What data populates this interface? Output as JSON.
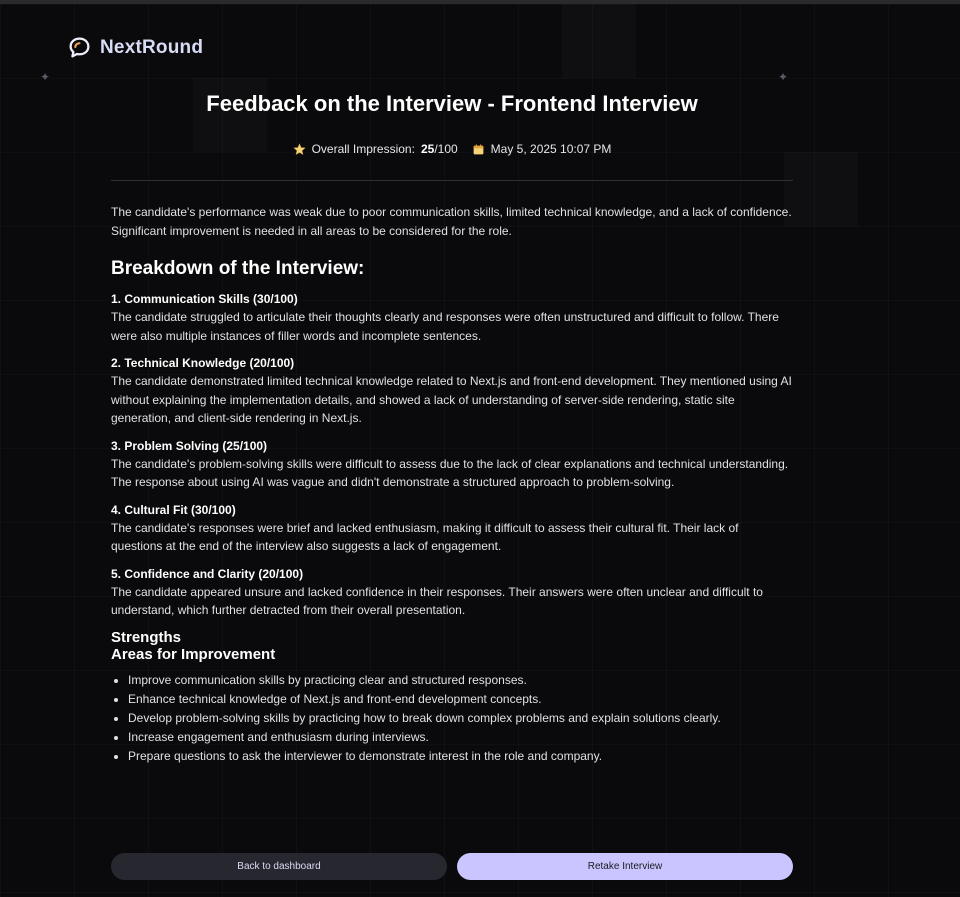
{
  "app": {
    "name": "NextRound"
  },
  "page": {
    "title": "Feedback on the Interview - Frontend Interview"
  },
  "meta": {
    "impression_label": "Overall Impression:",
    "score": "25",
    "score_max": "/100",
    "date": "May 5, 2025 10:07 PM"
  },
  "summary": "The candidate's performance was weak due to poor communication skills, limited technical knowledge, and a lack of confidence. Significant improvement is needed in all areas to be considered for the role.",
  "breakdown": {
    "heading": "Breakdown of the Interview:",
    "categories": [
      {
        "title": "1. Communication Skills (30/100)",
        "comment": "The candidate struggled to articulate their thoughts clearly and responses were often unstructured and difficult to follow. There were also multiple instances of filler words and incomplete sentences."
      },
      {
        "title": "2. Technical Knowledge (20/100)",
        "comment": "The candidate demonstrated limited technical knowledge related to Next.js and front-end development. They mentioned using AI without explaining the implementation details, and showed a lack of understanding of server-side rendering, static site generation, and client-side rendering in Next.js."
      },
      {
        "title": "3. Problem Solving (25/100)",
        "comment": "The candidate's problem-solving skills were difficult to assess due to the lack of clear explanations and technical understanding. The response about using AI was vague and didn't demonstrate a structured approach to problem-solving."
      },
      {
        "title": "4. Cultural Fit (30/100)",
        "comment": "The candidate's responses were brief and lacked enthusiasm, making it difficult to assess their cultural fit. Their lack of questions at the end of the interview also suggests a lack of engagement."
      },
      {
        "title": "5. Confidence and Clarity (20/100)",
        "comment": "The candidate appeared unsure and lacked confidence in their responses. Their answers were often unclear and difficult to understand, which further detracted from their overall presentation."
      }
    ]
  },
  "strengths": {
    "heading": "Strengths"
  },
  "improvements": {
    "heading": "Areas for Improvement",
    "items": [
      "Improve communication skills by practicing clear and structured responses.",
      "Enhance technical knowledge of Next.js and front-end development concepts.",
      "Develop problem-solving skills by practicing how to break down complex problems and explain solutions clearly.",
      "Increase engagement and enthusiasm during interviews.",
      "Prepare questions to ask the interviewer to demonstrate interest in the role and company."
    ]
  },
  "buttons": {
    "back": "Back to dashboard",
    "retake": "Retake Interview"
  },
  "colors": {
    "background": "#0a0a0c",
    "primary_button": "#cac5fe",
    "secondary_button": "#27272f",
    "logo_text": "#d8dcf5"
  },
  "icons": {
    "logo": "chat-bubble-icon",
    "impression": "star-icon",
    "date": "calendar-icon"
  }
}
